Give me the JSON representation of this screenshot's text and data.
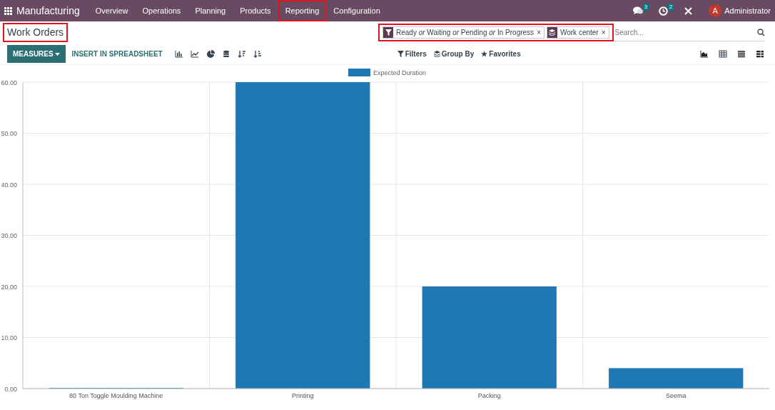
{
  "navbar": {
    "app_name": "Manufacturing",
    "menu": [
      {
        "label": "Overview",
        "highlighted": false
      },
      {
        "label": "Operations",
        "highlighted": false
      },
      {
        "label": "Planning",
        "highlighted": false
      },
      {
        "label": "Products",
        "highlighted": false
      },
      {
        "label": "Reporting",
        "highlighted": true
      },
      {
        "label": "Configuration",
        "highlighted": false
      }
    ],
    "messages_count": "3",
    "activities_count": "2",
    "user_initial": "A",
    "user_name": "Administrator"
  },
  "title": {
    "text": "Work Orders",
    "highlighted": true
  },
  "toolbar": {
    "measures": "MEASURES",
    "insert": "INSERT IN SPREADSHEET"
  },
  "search": {
    "highlighted": true,
    "placeholder": "Search...",
    "facets": [
      {
        "kind": "filter",
        "text": "Ready *or* Waiting *or* Pending *or* In Progress",
        "close": "×"
      },
      {
        "kind": "groupby",
        "text": "Work center",
        "close": "×"
      }
    ]
  },
  "search_options": [
    {
      "kind": "filter",
      "label": "Filters"
    },
    {
      "kind": "groupby",
      "label": "Group By"
    },
    {
      "kind": "favorite",
      "label": "Favorites"
    }
  ],
  "chart": {
    "chart_data": {
      "type": "bar",
      "grid": true,
      "categories": [
        "80 Ton Toggle Moulding Machine",
        "Printing",
        "Packing",
        "Seema"
      ],
      "series": [
        {
          "name": "Expected Duration",
          "color": "#1f77b4",
          "values": [
            0,
            60,
            20,
            4
          ]
        }
      ],
      "ylim": [
        0,
        60
      ],
      "yticks": [
        {
          "value": 0,
          "label": "0.00"
        },
        {
          "value": 10,
          "label": "10.00"
        },
        {
          "value": 20,
          "label": "20.00"
        },
        {
          "value": 30,
          "label": "30.00"
        },
        {
          "value": 40,
          "label": "40.00"
        },
        {
          "value": 50,
          "label": "50.00"
        },
        {
          "value": 60,
          "label": "60.00"
        }
      ]
    }
  }
}
